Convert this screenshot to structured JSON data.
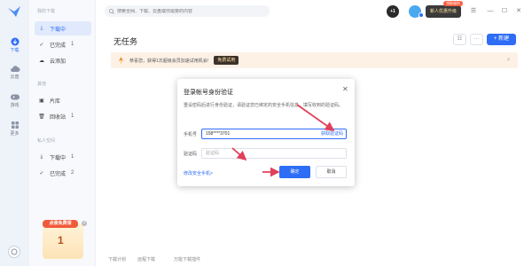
{
  "rail": {
    "items": [
      {
        "label": "下载",
        "icon": "download-icon"
      },
      {
        "label": "云盘",
        "icon": "cloud-icon"
      },
      {
        "label": "游戏",
        "icon": "gamepad-icon"
      },
      {
        "label": "更多",
        "icon": "grid-icon"
      }
    ]
  },
  "sidebar": {
    "section1": "我的下载",
    "items1": [
      {
        "label": "下载中",
        "count": ""
      },
      {
        "label": "已完成",
        "count": "1"
      },
      {
        "label": "云添加",
        "count": ""
      }
    ],
    "section2": "其他",
    "items2": [
      {
        "label": "片库",
        "count": ""
      },
      {
        "label": "回收站",
        "count": "1"
      }
    ],
    "section3": "私人空间",
    "items3": [
      {
        "label": "下载中",
        "count": "1"
      },
      {
        "label": "已完成",
        "count": "2"
      }
    ],
    "promo": {
      "tag": "点我免费领",
      "number": "1"
    }
  },
  "topbar": {
    "search_placeholder": "搜索全网、下载、云盘或你需要的内容",
    "coin": "+1",
    "newbie": "新人优惠升级",
    "newbie_tag": "领取福利"
  },
  "main": {
    "title": "无任务",
    "new_button": "+ 新建",
    "banner_text": "恭喜您，获得1次超级会员加速试用机会!",
    "banner_button": "免费试用",
    "footer": [
      "下载计划",
      "远程下载",
      "万能下载插件"
    ]
  },
  "dialog": {
    "title": "登录帐号身份验证",
    "desc": "重设密码后进行身份验证，请验证您已绑定的安全手机信息，填写收到的验证码。",
    "phone_label": "手机号",
    "phone_value": "158****3701",
    "get_code": "获取验证码",
    "code_label": "验证码",
    "code_placeholder": "验证码",
    "change_phone": "修改安全手机>",
    "ok": "确定",
    "cancel": "取消"
  },
  "colors": {
    "accent": "#2e6df6",
    "annotation": "#e0405a"
  }
}
